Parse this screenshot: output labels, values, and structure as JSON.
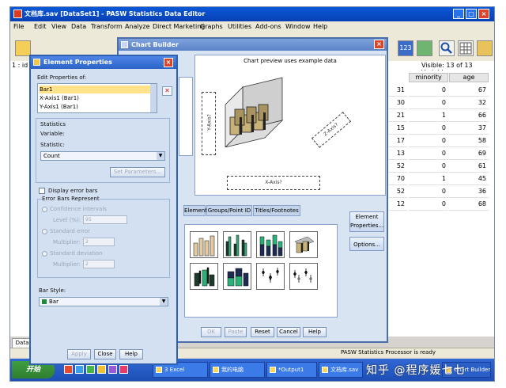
{
  "main_window": {
    "title": "文档库.sav [DataSet1] - PASW Statistics Data Editor",
    "menu": [
      "File",
      "Edit",
      "View",
      "Data",
      "Transform",
      "Analyze",
      "Direct Marketing",
      "Graphs",
      "Utilities",
      "Add-ons",
      "Window",
      "Help"
    ],
    "row_label": "1 : id",
    "visible_label": "Visible: 13 of 13 Variables",
    "toolbar_badge": "123",
    "columns": [
      "minority",
      "age"
    ],
    "row_prefixes": [
      "31",
      "30",
      "21",
      "15",
      "17",
      "13",
      "52",
      "70",
      "52",
      "12"
    ],
    "minority": [
      "0",
      "0",
      "1",
      "0",
      "0",
      "0",
      "0",
      "1",
      "0",
      "0"
    ],
    "age": [
      "67",
      "32",
      "66",
      "37",
      "58",
      "69",
      "61",
      "45",
      "36",
      "68"
    ],
    "data_tab": "Data",
    "status": "PASW Statistics Processor is ready"
  },
  "chart_builder": {
    "title": "Chart Builder",
    "preview_caption": "Chart preview uses example data",
    "y_axis": "Y-Axis?",
    "x_axis": "X-Axis?",
    "z_axis": "Z-Axis?",
    "tabs": [
      "Elements",
      "Groups/Point ID",
      "Titles/Footnotes"
    ],
    "element_properties_button": "Element Properties...",
    "options_button": "Options...",
    "buttons": [
      "OK",
      "Paste",
      "Reset",
      "Cancel",
      "Help"
    ]
  },
  "element_properties": {
    "title": "Element Properties",
    "edit_properties_of": "Edit Properties of:",
    "items": [
      "Bar1",
      "X-Axis1 (Bar1)",
      "Y-Axis1 (Bar1)"
    ],
    "statistics_heading": "Statistics",
    "variable_label": "Variable:",
    "statistic_label": "Statistic:",
    "statistic_value": "Count",
    "set_parameters": "Set Parameters...",
    "display_error_bars": "Display error bars",
    "error_bars_represent": "Error Bars Represent",
    "confidence_intervals": "Confidence intervals",
    "level_label": "Level (%):",
    "level_value": "95",
    "standard_error": "Standard error",
    "se_multiplier_label": "Multiplier:",
    "se_multiplier_value": "2",
    "standard_deviation": "Standard deviation",
    "sd_multiplier_label": "Multiplier:",
    "sd_multiplier_value": "2",
    "bar_style_label": "Bar Style:",
    "bar_style_value": "Bar",
    "buttons": [
      "Apply",
      "Close",
      "Help"
    ]
  },
  "taskbar": {
    "start": "开始",
    "tasks": [
      "3 Excel",
      "我的电脑",
      "*Output1",
      "文档库.sav",
      "Chart Builder"
    ],
    "watermark": "知乎 @程序媛七七"
  },
  "colors": {
    "xp_blue": "#0a58d8",
    "dialog_bg": "#d9e4f3",
    "selected": "#ffe28a"
  }
}
